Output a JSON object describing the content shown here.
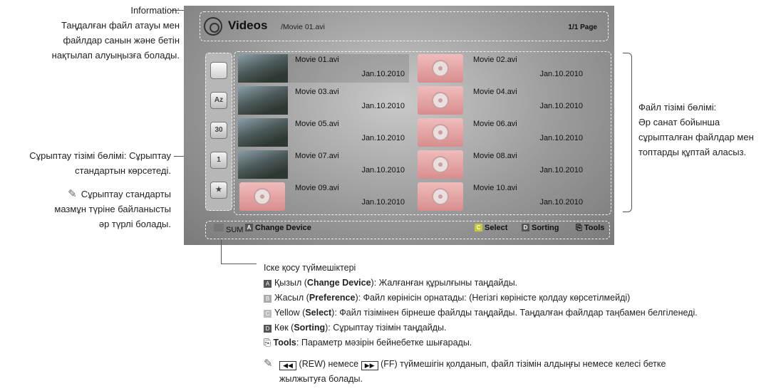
{
  "annotations": {
    "information": [
      "Information:",
      "Таңдалған файл атауы мен",
      "файлдар санын және бетін",
      "нақтылап алуыңызға болады."
    ],
    "sort_list": [
      "Сұрыптау тізімі бөлімі: Сұрыптау",
      "стандартын көрсетеді."
    ],
    "sort_note": [
      "Сұрыптау стандарты",
      "мазмұн түріне байланысты",
      "әр түрлі болады."
    ],
    "file_list": [
      "Файл тізімі бөлімі:",
      "Әр санат бойынша",
      "сұрыпталған файлдар мен",
      "топтарды құптай аласыз."
    ]
  },
  "screen": {
    "title": "Videos",
    "path": "/Movie 01.avi",
    "page": "1/1 Page",
    "sidebar_icons": [
      "folder-icon",
      "az-sort-icon",
      "calendar-30-icon",
      "calendar-1-icon",
      "star-icon"
    ],
    "files": [
      {
        "name": "Movie 01.avi",
        "date": "Jan.10.2010",
        "thumb": "photo"
      },
      {
        "name": "Movie 02.avi",
        "date": "Jan.10.2010",
        "thumb": "icon"
      },
      {
        "name": "Movie 03.avi",
        "date": "Jan.10.2010",
        "thumb": "photo"
      },
      {
        "name": "Movie 04.avi",
        "date": "Jan.10.2010",
        "thumb": "icon"
      },
      {
        "name": "Movie 05.avi",
        "date": "Jan.10.2010",
        "thumb": "photo"
      },
      {
        "name": "Movie 06.avi",
        "date": "Jan.10.2010",
        "thumb": "icon"
      },
      {
        "name": "Movie 07.avi",
        "date": "Jan.10.2010",
        "thumb": "photo"
      },
      {
        "name": "Movie 08.avi",
        "date": "Jan.10.2010",
        "thumb": "icon"
      },
      {
        "name": "Movie 09.avi",
        "date": "Jan.10.2010",
        "thumb": "icon"
      },
      {
        "name": "Movie 10.avi",
        "date": "Jan.10.2010",
        "thumb": "icon"
      }
    ],
    "footer": {
      "sum": "SUM",
      "change_key": "A",
      "change_device": "Change Device",
      "select_key": "C",
      "select": "Select",
      "sorting_key": "D",
      "sorting": "Sorting",
      "tools": "Tools"
    }
  },
  "instructions": {
    "heading": "Іске қосу түймешіктері",
    "a_key": "A",
    "a_pre": "Қызыл (",
    "a_bold": "Change Device",
    "a_post": "): Жалғанған құрылғыны таңдайды.",
    "b_key": "B",
    "b_pre": "Жасыл (",
    "b_bold": "Preference",
    "b_post": "): Файл көрінісін орнатады: (Негізгі көріністе қолдау көрсетілмейді)",
    "c_key": "C",
    "c_pre": "Yellow (",
    "c_bold": "Select",
    "c_post": "): Файл тізімінен бірнеше файлды таңдайды. Таңдалған файлдар таңбамен белгіленеді.",
    "d_key": "D",
    "d_pre": "Көк (",
    "d_bold": "Sorting",
    "d_post": "): Сұрыптау тізімін таңдайды.",
    "tools_bold": "Tools",
    "tools_post": ": Параметр мәзірін бейнебетке шығарады.",
    "note_rew": "(REW) немесе",
    "note_ff": "(FF) түймешігін қолданып, файл тізімін алдыңғы немесе келесі бетке",
    "note_line2": "жылжытуға болады."
  }
}
